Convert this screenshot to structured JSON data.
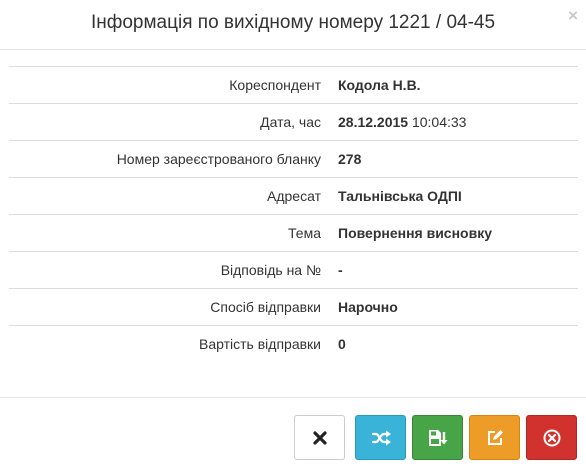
{
  "modal": {
    "title": "Інформація по вихідному номеру 1221 / 04-45",
    "close_symbol": "×"
  },
  "fields": [
    {
      "label": "Кореспондент",
      "value": "Кодола Н.В."
    },
    {
      "label": "Дата, час",
      "value": "28.12.2015",
      "extra": "10:04:33"
    },
    {
      "label": "Номер зареєстрованого бланку",
      "value": "278"
    },
    {
      "label": "Адресат",
      "value": "Тальнівська ОДПІ"
    },
    {
      "label": "Тема",
      "value": "Повернення висновку"
    },
    {
      "label": "Відповідь на №",
      "value": "-"
    },
    {
      "label": "Спосіб відправки",
      "value": "Нарочно"
    },
    {
      "label": "Вартість відправки",
      "value": "0"
    }
  ],
  "footer": {
    "buttons": [
      {
        "icon": "close-icon",
        "color": "#ffffff"
      },
      {
        "icon": "random-icon",
        "color": "#39b3d7"
      },
      {
        "icon": "save-icon",
        "color": "#47a447"
      },
      {
        "icon": "edit-icon",
        "color": "#ed9c28"
      },
      {
        "icon": "remove-circle-icon",
        "color": "#d2322d"
      }
    ]
  }
}
